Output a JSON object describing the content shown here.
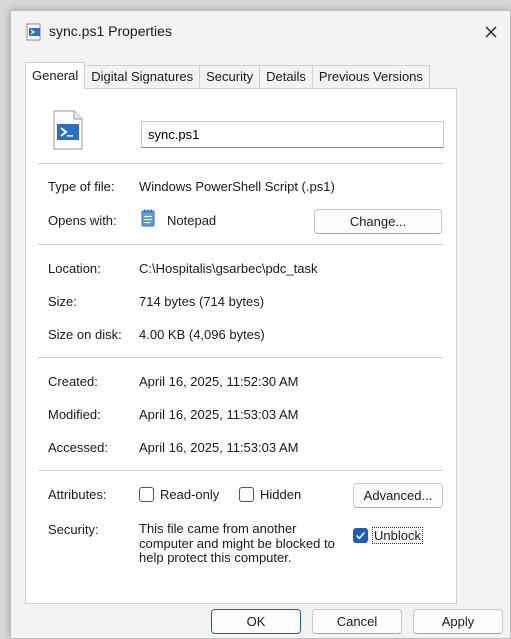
{
  "window": {
    "title": "sync.ps1 Properties"
  },
  "tabs": [
    {
      "label": "General",
      "active": true
    },
    {
      "label": "Digital Signatures",
      "active": false
    },
    {
      "label": "Security",
      "active": false
    },
    {
      "label": "Details",
      "active": false
    },
    {
      "label": "Previous Versions",
      "active": false
    }
  ],
  "general": {
    "filename": "sync.ps1",
    "type_label": "Type of file:",
    "type_value": "Windows PowerShell Script (.ps1)",
    "opens_label": "Opens with:",
    "opens_value": "Notepad",
    "change_button": "Change...",
    "location_label": "Location:",
    "location_value": "C:\\Hospitalis\\gsarbec\\pdc_task",
    "size_label": "Size:",
    "size_value": "714 bytes (714 bytes)",
    "size_disk_label": "Size on disk:",
    "size_disk_value": "4.00 KB (4,096 bytes)",
    "created_label": "Created:",
    "created_value": "April 16, 2025, 11:52:30 AM",
    "modified_label": "Modified:",
    "modified_value": "April 16, 2025, 11:53:03 AM",
    "accessed_label": "Accessed:",
    "accessed_value": "April 16, 2025, 11:53:03 AM",
    "attributes_label": "Attributes:",
    "readonly_label": "Read-only",
    "readonly_checked": false,
    "hidden_label": "Hidden",
    "hidden_checked": false,
    "advanced_button": "Advanced...",
    "security_label": "Security:",
    "security_text": "This file came from another computer and might be blocked to help protect this computer.",
    "unblock_label": "Unblock",
    "unblock_checked": true
  },
  "footer": {
    "ok": "OK",
    "cancel": "Cancel",
    "apply": "Apply"
  },
  "colors": {
    "accent": "#1a5fb4"
  },
  "icons": [
    "powershell-script-icon",
    "close-icon",
    "notepad-icon",
    "checkmark-icon"
  ]
}
